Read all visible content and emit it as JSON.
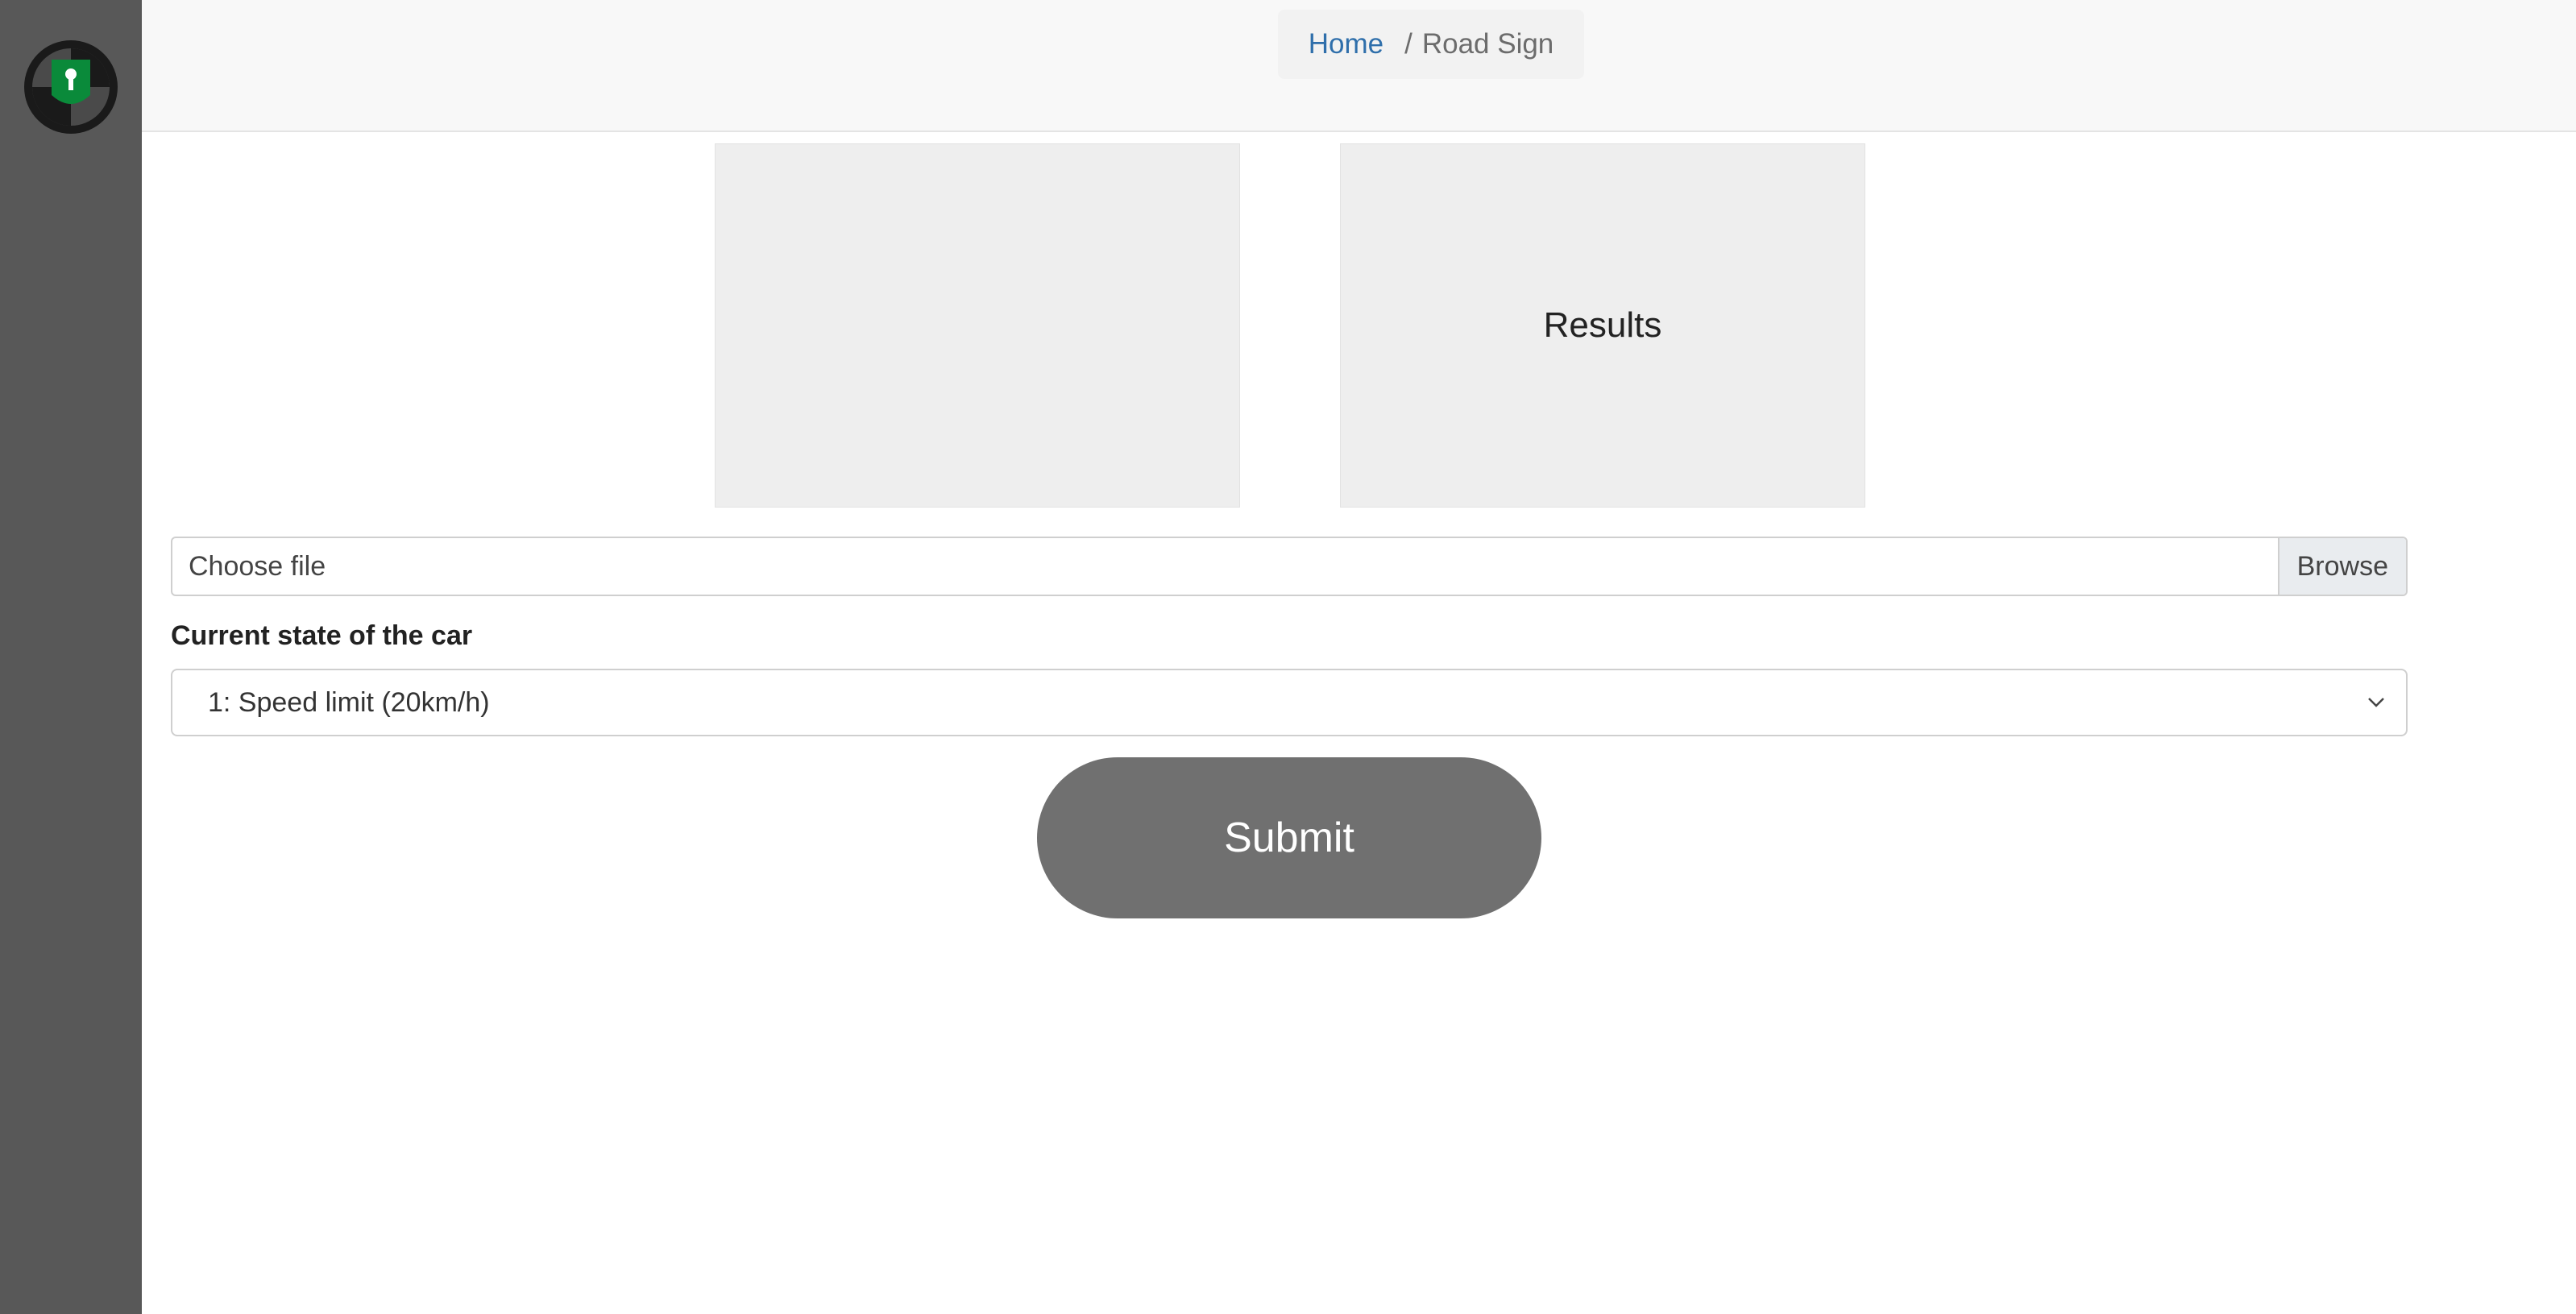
{
  "sidebar": {
    "logo_icon": "steering-wheel-keyhole-icon",
    "logo_colors": {
      "ring": "#1a1a1a",
      "accent": "#0a8a3a",
      "ring_fill": "#4a4a4a"
    }
  },
  "breadcrumb": {
    "home_label": "Home",
    "separator": "/",
    "current_label": "Road Sign"
  },
  "preview": {
    "results_label": "Results"
  },
  "upload": {
    "placeholder": "Choose file",
    "browse_label": "Browse"
  },
  "car_state": {
    "label": "Current state of the car",
    "selected_option": "1: Speed limit (20km/h)"
  },
  "submit": {
    "label": "Submit"
  },
  "colors": {
    "sidebar": "#585858",
    "link": "#2f6fab",
    "submit_bg": "#707070",
    "panel_bg": "#eeeeee"
  }
}
